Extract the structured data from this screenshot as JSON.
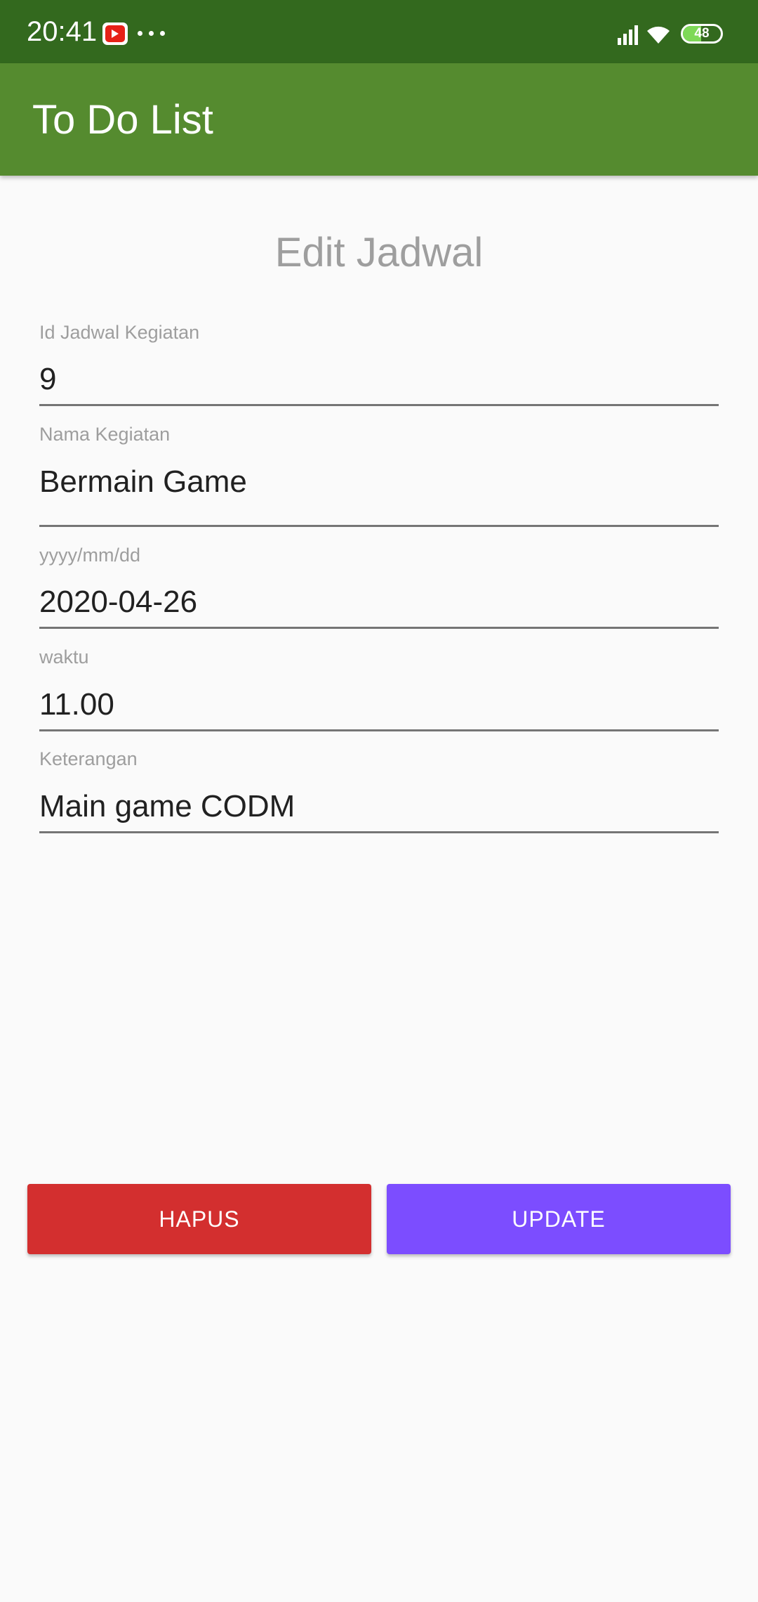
{
  "status_bar": {
    "time": "20:41",
    "battery_level": "48",
    "battery_fraction": 0.48,
    "icons": [
      "youtube-icon",
      "more-dots-icon",
      "signal-icon",
      "wifi-icon",
      "battery-icon"
    ]
  },
  "app_bar": {
    "title": "To Do List",
    "color": "#558b2f"
  },
  "form": {
    "heading": "Edit Jadwal",
    "fields": [
      {
        "label": "Id Jadwal Kegiatan",
        "value": "9"
      },
      {
        "label": "Nama Kegiatan",
        "value": "Bermain Game"
      },
      {
        "label": "yyyy/mm/dd",
        "value": "2020-04-26"
      },
      {
        "label": "waktu",
        "value": "11.00"
      },
      {
        "label": "Keterangan",
        "value": "Main game CODM"
      }
    ]
  },
  "actions": {
    "delete_label": "HAPUS",
    "update_label": "UPDATE",
    "delete_color": "#d32f2f",
    "update_color": "#7c4dff"
  }
}
